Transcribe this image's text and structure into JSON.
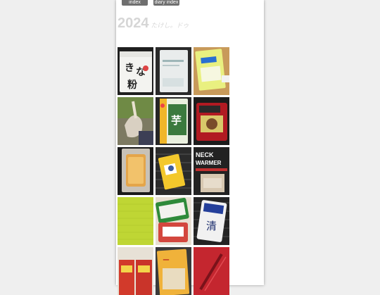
{
  "nav": {
    "index_label": "index",
    "diary_index_label": "diary index"
  },
  "header": {
    "year": "2024",
    "subtitle": "たけし。ドゥ"
  },
  "colors": {
    "page_bg": "#ffffff",
    "outer_bg": "#efefef",
    "nav_button_bg": "#6f6f6f",
    "title_gray": "#d6d6d6"
  },
  "thumbnails": [
    {
      "name": "kinako-flour-bag-photo",
      "icon": "kinako-package",
      "text": "きな粉"
    },
    {
      "name": "white-package-photo",
      "icon": "white-package",
      "text": ""
    },
    {
      "name": "yellow-green-package-photo",
      "icon": "yellow-package",
      "text": ""
    },
    {
      "name": "hand-with-plant-photo",
      "icon": "hand-plant",
      "text": ""
    },
    {
      "name": "green-tea-package-photo",
      "icon": "green-package",
      "text": "芋"
    },
    {
      "name": "red-package-photo",
      "icon": "red-package",
      "text": ""
    },
    {
      "name": "baked-cake-photo",
      "icon": "cake-tray",
      "text": ""
    },
    {
      "name": "yellow-snack-bag-photo",
      "icon": "yellow-bag",
      "text": ""
    },
    {
      "name": "neck-warmer-package-photo",
      "icon": "neck-warmer-package",
      "text": "NECK WARMER"
    },
    {
      "name": "lime-green-notebook-photo",
      "icon": "green-notebook",
      "text": ""
    },
    {
      "name": "rice-bag-photo",
      "icon": "rice-bag",
      "text": ""
    },
    {
      "name": "blue-label-bag-photo",
      "icon": "blue-label-bag",
      "text": "清"
    },
    {
      "name": "red-boxes-photo",
      "icon": "red-boxes",
      "text": ""
    },
    {
      "name": "orange-snack-photo",
      "icon": "orange-snack",
      "text": "ー"
    },
    {
      "name": "red-object-photo",
      "icon": "red-object",
      "text": ""
    }
  ]
}
